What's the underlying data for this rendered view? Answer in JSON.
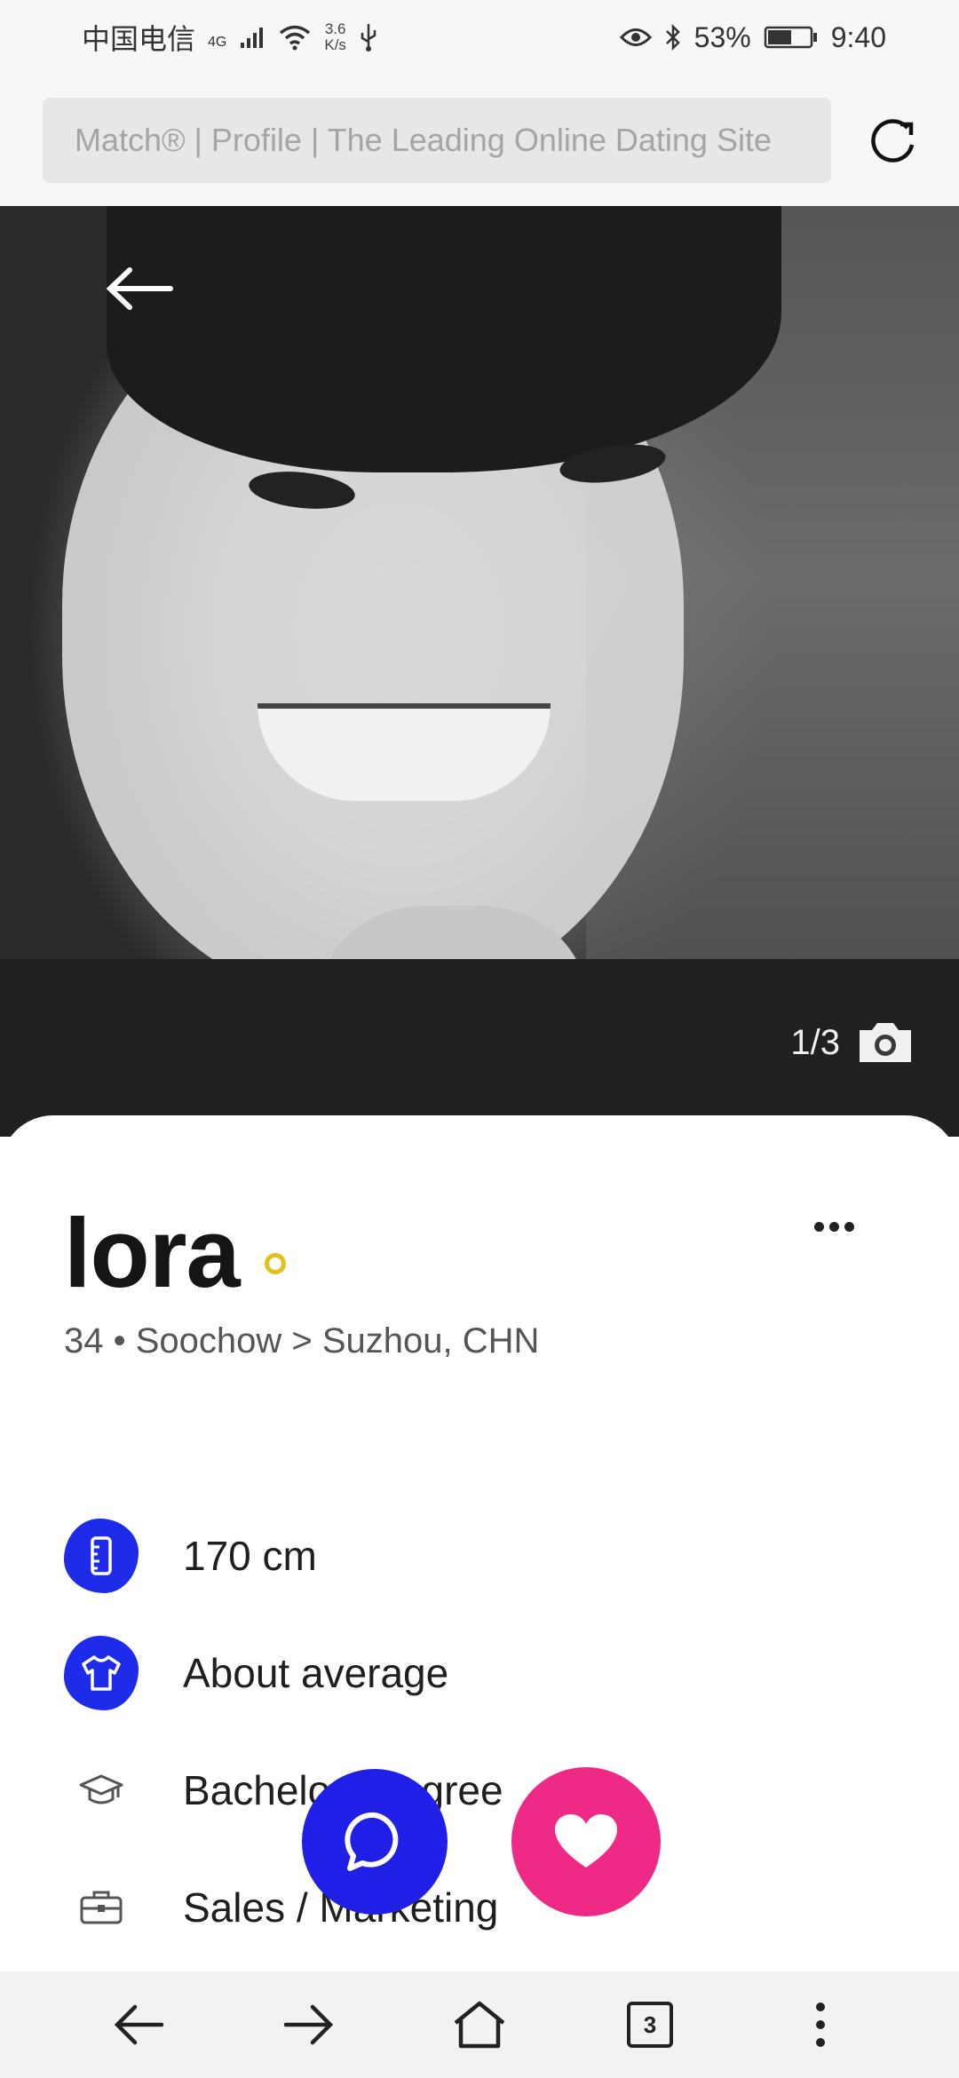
{
  "status_bar": {
    "carrier": "中国电信",
    "network_type": "4G",
    "speed_value": "3.6",
    "speed_unit": "K/s",
    "battery": "53%",
    "time": "9:40"
  },
  "browser": {
    "url_title": "Match® | Profile | The Leading Online Dating Site",
    "tabs_count": "3"
  },
  "photo": {
    "counter": "1/3"
  },
  "profile": {
    "name": "lora",
    "subtitle": "34 • Soochow > Suzhou, CHN",
    "details": [
      {
        "icon": "ruler-icon",
        "text": "170 cm"
      },
      {
        "icon": "shirt-icon",
        "text": "About average"
      },
      {
        "icon": "graduation-cap-icon",
        "text": "Bachelors degree"
      },
      {
        "icon": "briefcase-icon",
        "text": "Sales / Marketing"
      }
    ]
  },
  "colors": {
    "accent_blue": "#1e2be8",
    "like_pink": "#ee2a86",
    "online_yellow": "#e1c11a"
  }
}
